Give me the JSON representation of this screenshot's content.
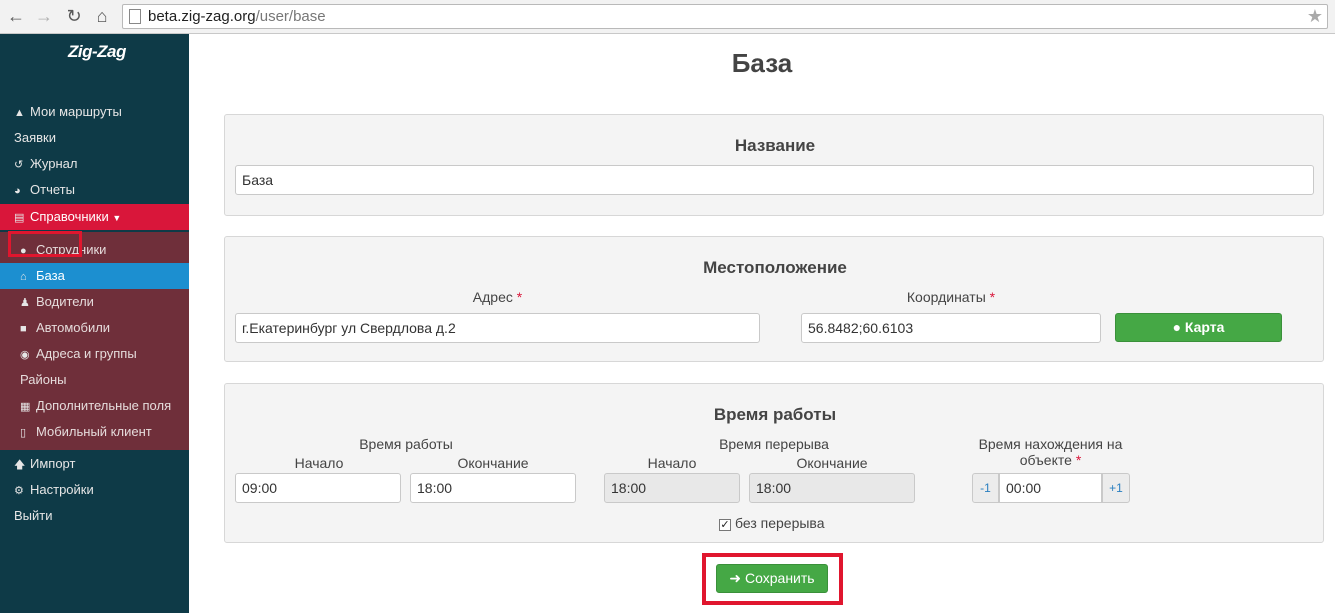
{
  "browser": {
    "url_host": "beta.zig-zag.org",
    "url_path": "/user/base"
  },
  "sidebar": {
    "logo": "Zig-Zag",
    "items": [
      {
        "label": "Мои маршруты",
        "icon": "road-icon"
      },
      {
        "label": "Заявки",
        "icon": ""
      },
      {
        "label": "Журнал",
        "icon": "history-icon"
      },
      {
        "label": "Отчеты",
        "icon": "pie-chart-icon"
      },
      {
        "label": "Справочники",
        "icon": "list-icon"
      }
    ],
    "sub_items": [
      {
        "label": "Сотрудники",
        "icon": "users-icon"
      },
      {
        "label": "База",
        "icon": "home-icon"
      },
      {
        "label": "Водители",
        "icon": "male-icon"
      },
      {
        "label": "Автомобили",
        "icon": "truck-icon"
      },
      {
        "label": "Адреса и группы",
        "icon": "globe-icon"
      },
      {
        "label": "Районы",
        "icon": ""
      },
      {
        "label": "Дополнительные поля",
        "icon": "table-icon"
      },
      {
        "label": "Мобильный клиент",
        "icon": "mobile-icon"
      }
    ],
    "bottom_items": [
      {
        "label": "Импорт",
        "icon": "arrow-up-icon"
      },
      {
        "label": "Настройки",
        "icon": "gear-icon"
      },
      {
        "label": "Выйти",
        "icon": ""
      }
    ]
  },
  "page": {
    "title": "База",
    "name_panel": {
      "heading": "Название",
      "value": "База"
    },
    "location_panel": {
      "heading": "Местоположение",
      "address_label": "Адрес",
      "address_value": "г.Екатеринбург ул Свердлова д.2",
      "coords_label": "Координаты",
      "coords_value": "56.8482;60.6103",
      "map_button": "Карта",
      "required_mark": "*"
    },
    "hours_panel": {
      "heading": "Время работы",
      "work_group": "Время работы",
      "break_group": "Время перерыва",
      "start_label": "Начало",
      "end_label": "Окончание",
      "work_start": "09:00",
      "work_end": "18:00",
      "break_start": "18:00",
      "break_end": "18:00",
      "stay_label_1": "Время нахождения на",
      "stay_label_2": "объекте",
      "stay_minus": "-1",
      "stay_value": "00:00",
      "stay_plus": "+1",
      "no_break_label": "без перерыва",
      "no_break_checked": true
    },
    "save_button": "Сохранить"
  },
  "colors": {
    "sidebar_bg": "#0e3a47",
    "active_red": "#d9163a",
    "submenu_bg": "#6f2f3a",
    "selected_blue": "#1c8fd0",
    "button_green": "#45a845"
  }
}
